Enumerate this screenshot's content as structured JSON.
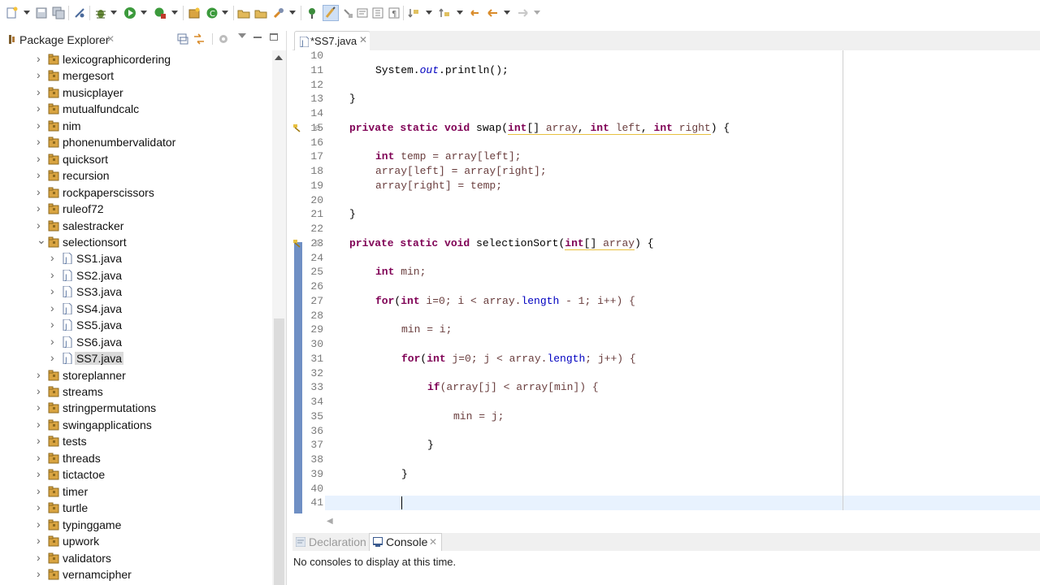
{
  "toolbar": {
    "icons": [
      "new-icon",
      "save-icon",
      "save-all-icon",
      "skip-breakpoints-icon",
      "debug-icon",
      "run-icon",
      "coverage-icon",
      "new-java-project-icon",
      "new-class-icon",
      "open-type-icon",
      "search-icon",
      "next-annotation-icon",
      "toggle-mark-occurrences-icon",
      "back-icon",
      "forward-icon"
    ]
  },
  "package_explorer": {
    "title": "Package Explorer",
    "items": [
      {
        "label": "lexicographicordering",
        "level": 0,
        "expanded": false
      },
      {
        "label": "mergesort",
        "level": 0,
        "expanded": false
      },
      {
        "label": "musicplayer",
        "level": 0,
        "expanded": false
      },
      {
        "label": "mutualfundcalc",
        "level": 0,
        "expanded": false
      },
      {
        "label": "nim",
        "level": 0,
        "expanded": false
      },
      {
        "label": "phonenumbervalidator",
        "level": 0,
        "expanded": false
      },
      {
        "label": "quicksort",
        "level": 0,
        "expanded": false
      },
      {
        "label": "recursion",
        "level": 0,
        "expanded": false
      },
      {
        "label": "rockpaperscissors",
        "level": 0,
        "expanded": false
      },
      {
        "label": "ruleof72",
        "level": 0,
        "expanded": false
      },
      {
        "label": "salestracker",
        "level": 0,
        "expanded": false
      },
      {
        "label": "selectionsort",
        "level": 0,
        "expanded": true
      },
      {
        "label": "SS1.java",
        "level": 1,
        "expanded": false
      },
      {
        "label": "SS2.java",
        "level": 1,
        "expanded": false
      },
      {
        "label": "SS3.java",
        "level": 1,
        "expanded": false
      },
      {
        "label": "SS4.java",
        "level": 1,
        "expanded": false
      },
      {
        "label": "SS5.java",
        "level": 1,
        "expanded": false
      },
      {
        "label": "SS6.java",
        "level": 1,
        "expanded": false
      },
      {
        "label": "SS7.java",
        "level": 1,
        "expanded": false,
        "selected": true
      },
      {
        "label": "storeplanner",
        "level": 0,
        "expanded": false
      },
      {
        "label": "streams",
        "level": 0,
        "expanded": false
      },
      {
        "label": "stringpermutations",
        "level": 0,
        "expanded": false
      },
      {
        "label": "swingapplications",
        "level": 0,
        "expanded": false
      },
      {
        "label": "tests",
        "level": 0,
        "expanded": false
      },
      {
        "label": "threads",
        "level": 0,
        "expanded": false
      },
      {
        "label": "tictactoe",
        "level": 0,
        "expanded": false
      },
      {
        "label": "timer",
        "level": 0,
        "expanded": false
      },
      {
        "label": "turtle",
        "level": 0,
        "expanded": false
      },
      {
        "label": "typinggame",
        "level": 0,
        "expanded": false
      },
      {
        "label": "upwork",
        "level": 0,
        "expanded": false
      },
      {
        "label": "validators",
        "level": 0,
        "expanded": false
      },
      {
        "label": "vernamcipher",
        "level": 0,
        "expanded": false
      }
    ]
  },
  "editor": {
    "tab_label": "*SS7.java",
    "line_numbers": [
      "10",
      "11",
      "12",
      "13",
      "14",
      "15",
      "16",
      "17",
      "18",
      "19",
      "20",
      "21",
      "22",
      "23",
      "24",
      "25",
      "26",
      "27",
      "28",
      "29",
      "30",
      "31",
      "32",
      "33",
      "34",
      "35",
      "36",
      "37",
      "38",
      "39",
      "40",
      "41"
    ],
    "code": {
      "l11_a": "System.",
      "l11_b": "out",
      "l11_c": ".println();",
      "l13": "}",
      "l15_kw": "private static void",
      "l15_name": " swap(",
      "l15_int1": "int",
      "l15_p1": "[] ",
      "l15_v1": "array",
      "l15_c1": ", ",
      "l15_int2": "int",
      "l15_v2": " left",
      "l15_c2": ", ",
      "l15_int3": "int",
      "l15_v3": " right",
      "l15_end": ") {",
      "l17_kw": "int",
      "l17_rest": " temp = array[left];",
      "l18": "array[left] = array[right];",
      "l19": "array[right] = temp;",
      "l21": "}",
      "l23_kw": "private static void",
      "l23_name": " selectionSort(",
      "l23_int": "int",
      "l23_p": "[] ",
      "l23_v": "array",
      "l23_end": ") {",
      "l25_kw": "int",
      "l25_rest": " min;",
      "l27_kw": "for",
      "l27_a": "(",
      "l27_int": "int",
      "l27_b": " i=0; i < array.",
      "l27_len": "length",
      "l27_c": " - 1; i++) {",
      "l29": "min = i;",
      "l31_kw": "for",
      "l31_a": "(",
      "l31_int": "int",
      "l31_b": " j=0; j < array.",
      "l31_len": "length",
      "l31_c": "; j++) {",
      "l33_kw": "if",
      "l33_rest": "(array[j] < array[min]) {",
      "l35": "min = j;",
      "l37": "}",
      "l39": "}"
    }
  },
  "bottom": {
    "tab_declaration": "Declaration",
    "tab_console": "Console",
    "console_message": "No consoles to display at this time."
  },
  "colors": {
    "keyword": "#7f0055",
    "field": "#0000c0",
    "current_line": "#e8f2fe",
    "range_indicator": "#6f8fc4"
  }
}
